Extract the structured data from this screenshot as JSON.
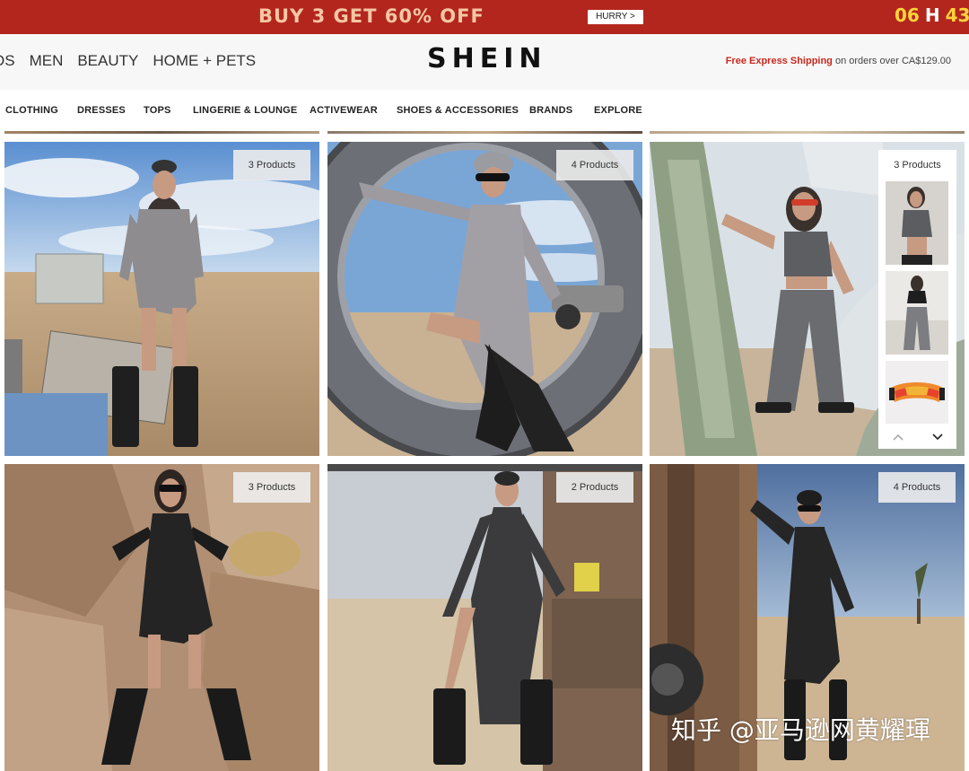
{
  "promo": {
    "title": "BUY 3 GET 60% OFF",
    "cta": "HURRY >",
    "hours": "06",
    "hours_unit": "H",
    "minutes": "43"
  },
  "header": {
    "nav": [
      "OS",
      "MEN",
      "BEAUTY",
      "HOME + PETS"
    ],
    "logo": "SHEIN",
    "shipping_highlight": "Free Express Shipping",
    "shipping_rest": " on orders over CA$129.00"
  },
  "categories": [
    "CLOTHING",
    "DRESSES",
    "TOPS",
    "LINGERIE & LOUNGE",
    "ACTIVEWEAR",
    "SHOES & ACCESSORIES",
    "BRANDS",
    "EXPLORE"
  ],
  "tiles": [
    {
      "badge": "3 Products",
      "outfit": "grey mini dress with shrug and black boots"
    },
    {
      "badge": "4 Products",
      "outfit": "grey high-slit dress with arm sleeves"
    },
    {
      "badge": "",
      "outfit": "grey cowl crop top with cargo pants"
    },
    {
      "badge": "3 Products",
      "outfit": "black knit dress with gloves"
    },
    {
      "badge": "2 Products",
      "outfit": "dark grey split maxi dress"
    },
    {
      "badge": "4 Products",
      "outfit": "black cut-out dress"
    }
  ],
  "carousel": {
    "label": "3 Products",
    "items": [
      "grey cowl crop top",
      "black crop top and grey pants",
      "mirrored sport sunglasses"
    ],
    "up_icon": "chevron-up-icon",
    "down_icon": "chevron-down-icon"
  },
  "watermark": "知乎 @亚马逊网黄耀琿",
  "colors": {
    "promo_bg": "#b3261e",
    "promo_text": "#f4c7a4",
    "countdown": "#ffd43a",
    "shipping_red": "#c8281e"
  }
}
